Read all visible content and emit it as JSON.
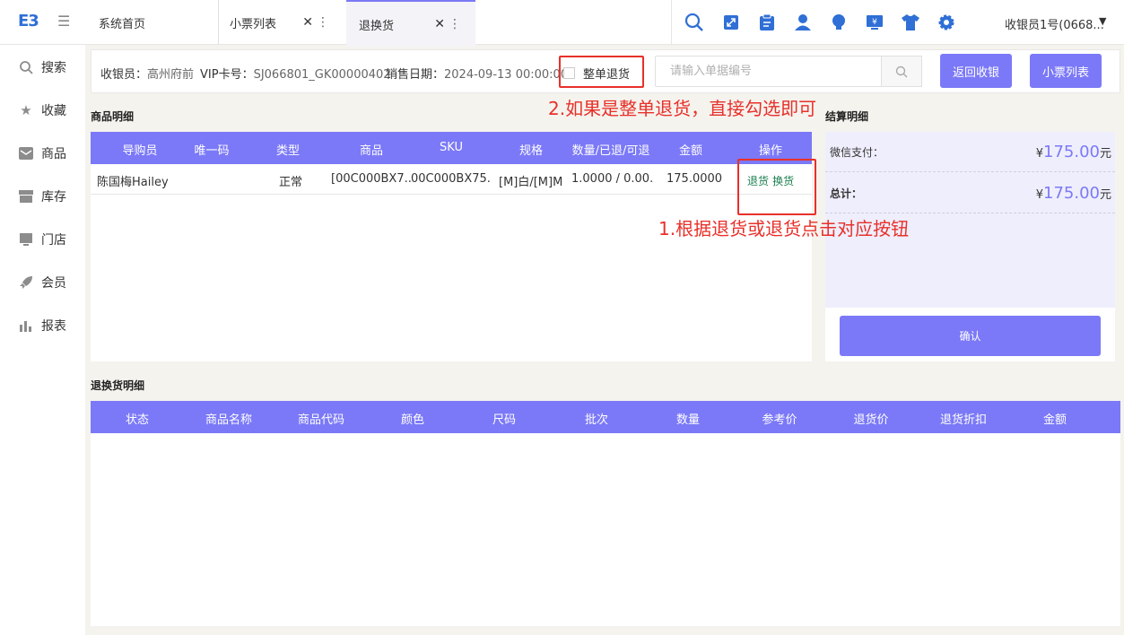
{
  "app": {
    "logo": "E3",
    "user": "收银员1号(0668..."
  },
  "tabs": [
    {
      "label": "系统首页"
    },
    {
      "label": "小票列表"
    },
    {
      "label": "退换货"
    }
  ],
  "toolbar_icons": [
    "search-icon",
    "expand-icon",
    "clipboard-icon",
    "user-icon",
    "bulb-icon",
    "cashier-icon",
    "shirt-icon",
    "gear-icon"
  ],
  "sidebar": {
    "items": [
      {
        "label": "搜索",
        "icon": "search-icon"
      },
      {
        "label": "收藏",
        "icon": "star-icon"
      },
      {
        "label": "商品",
        "icon": "mail-icon"
      },
      {
        "label": "库存",
        "icon": "inventory-icon"
      },
      {
        "label": "门店",
        "icon": "store-icon"
      },
      {
        "label": "会员",
        "icon": "rocket-icon"
      },
      {
        "label": "报表",
        "icon": "chart-icon"
      }
    ]
  },
  "filter": {
    "cashier_label": "收银员：",
    "cashier_value": "高州府前",
    "vip_label": "VIP卡号：",
    "vip_value": "SJ066801_GK00000402",
    "date_label": "销售日期：",
    "date_value": "2024-09-13 00:00:00",
    "whole_return_label": "整单退货",
    "whole_return_checked": false,
    "order_placeholder": "请输入单据编号",
    "order_value": "",
    "back_button": "返回收银",
    "receipts_button": "小票列表"
  },
  "products": {
    "title": "商品明细",
    "columns": [
      "导购员",
      "唯一码",
      "类型",
      "商品",
      "SKU",
      "规格",
      "数量/已退/可退",
      "金额",
      "操作"
    ],
    "rows": [
      {
        "guide": "陈国梅Hailey",
        "unique_code": "",
        "type": "正常",
        "product": "[00C000BX7...",
        "sku": "00C000BX75...",
        "spec": "[M]白/[M]M",
        "qty": "1.0000 / 0.00...",
        "amount": "175.0000",
        "op_return": "退货",
        "op_exchange": "换货"
      }
    ]
  },
  "settlement": {
    "title": "结算明细",
    "rows": [
      {
        "label": "微信支付：",
        "currency": "¥",
        "value": "175.00",
        "unit": "元"
      },
      {
        "label": "总计：",
        "currency": "¥",
        "value": "175.00",
        "unit": "元"
      }
    ],
    "confirm_button": "确认"
  },
  "returns": {
    "title": "退换货明细",
    "columns": [
      "状态",
      "商品名称",
      "商品代码",
      "颜色",
      "尺码",
      "批次",
      "数量",
      "参考价",
      "退货价",
      "退货折扣",
      "金额"
    ]
  },
  "annotations": {
    "note1": "1.根据退货或退货点击对应按钮",
    "note2": "2.如果是整单退货，直接勾选即可"
  }
}
